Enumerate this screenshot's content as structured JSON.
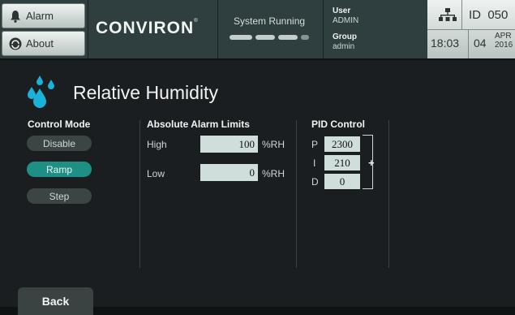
{
  "header": {
    "alarm_label": "Alarm",
    "about_label": "About",
    "brand": "CONVIRON",
    "brand_mark": "®",
    "status_text": "System Running",
    "user_key": "User",
    "user_value": "ADMIN",
    "group_key": "Group",
    "group_value": "admin",
    "id_label": "ID",
    "id_value": "050",
    "time": "18:03",
    "day": "04",
    "month": "APR",
    "year": "2016"
  },
  "page": {
    "title": "Relative Humidity",
    "icon": "water-drops-icon",
    "accent": "#1ab2d8"
  },
  "control_mode": {
    "title": "Control Mode",
    "options": [
      "Disable",
      "Ramp",
      "Step"
    ],
    "selected": "Ramp",
    "active_color": "#1e8f84"
  },
  "alarm_limits": {
    "title": "Absolute Alarm Limits",
    "high_label": "High",
    "high_value": "100",
    "low_label": "Low",
    "low_value": "0",
    "unit": "%RH"
  },
  "pid": {
    "title": "PID Control",
    "p_label": "P",
    "p_value": "2300",
    "i_label": "I",
    "i_value": "210",
    "d_label": "D",
    "d_value": "0",
    "expand_symbol": "+"
  },
  "footer": {
    "back_label": "Back"
  }
}
